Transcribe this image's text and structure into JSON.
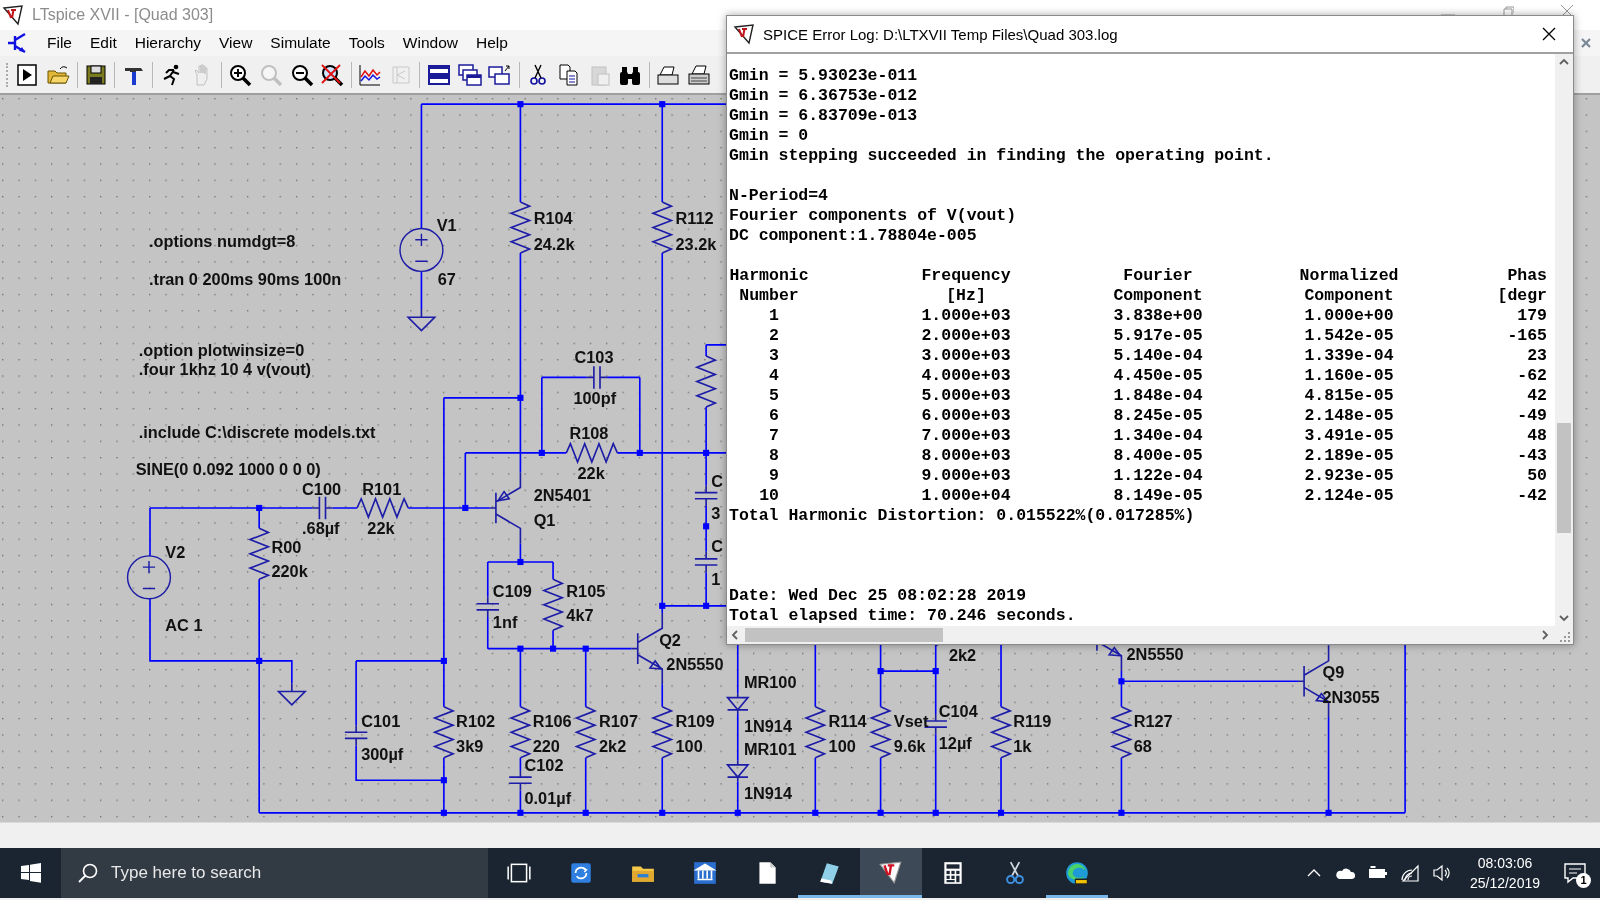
{
  "main_window": {
    "title": "LTspice XVII - [Quad 303]"
  },
  "menu": [
    "File",
    "Edit",
    "Hierarchy",
    "View",
    "Simulate",
    "Tools",
    "Window",
    "Help"
  ],
  "toolbar": [
    {
      "kind": "run",
      "disabled": false
    },
    {
      "kind": "open",
      "disabled": false
    },
    {
      "kind": "separator"
    },
    {
      "kind": "save",
      "disabled": false
    },
    {
      "kind": "separator"
    },
    {
      "kind": "hammer",
      "disabled": false
    },
    {
      "kind": "separator"
    },
    {
      "kind": "runner",
      "disabled": false
    },
    {
      "kind": "hand",
      "disabled": true
    },
    {
      "kind": "separator"
    },
    {
      "kind": "zoom-in",
      "disabled": false
    },
    {
      "kind": "zoom-area",
      "disabled": true
    },
    {
      "kind": "zoom-out",
      "disabled": false
    },
    {
      "kind": "zoom-cancel",
      "disabled": false
    },
    {
      "kind": "separator"
    },
    {
      "kind": "waveform",
      "disabled": false
    },
    {
      "kind": "symbol",
      "disabled": true
    },
    {
      "kind": "separator"
    },
    {
      "kind": "tile-horizontal",
      "disabled": false
    },
    {
      "kind": "cascade",
      "disabled": false
    },
    {
      "kind": "tile-vertical",
      "disabled": false
    },
    {
      "kind": "separator"
    },
    {
      "kind": "cut",
      "disabled": false
    },
    {
      "kind": "copy",
      "disabled": false
    },
    {
      "kind": "paste",
      "disabled": true
    },
    {
      "kind": "find",
      "disabled": false
    },
    {
      "kind": "separator"
    },
    {
      "kind": "print",
      "disabled": false
    },
    {
      "kind": "print-setup",
      "disabled": false
    }
  ],
  "schematic": {
    "directives": [
      ".options numdgt=8",
      ".tran 0 200ms 90ms 100n",
      ".option plotwinsize=0",
      ".four 1khz 10 4 v(vout)",
      ".include C:\\discrete models.txt"
    ],
    "parts": [
      {
        "kind": "voltage_source",
        "labels": [
          "V1",
          "67"
        ]
      },
      {
        "kind": "resistor",
        "labels": [
          "R104",
          "24.2k"
        ]
      },
      {
        "kind": "resistor",
        "labels": [
          "R112",
          "23.2k"
        ]
      },
      {
        "kind": "capacitor",
        "labels": [
          "C103",
          "100pf"
        ]
      },
      {
        "kind": "resistor",
        "labels": [
          "R108",
          "22k"
        ]
      },
      {
        "kind": "capacitor",
        "labels": [
          "C100",
          ".68µf"
        ]
      },
      {
        "kind": "resistor",
        "labels": [
          "R101",
          "22k"
        ]
      },
      {
        "kind": "pnp",
        "labels": [
          "2N5401",
          "Q1"
        ]
      },
      {
        "kind": "voltage_source",
        "labels": [
          "SINE(0 0.092 1000 0 0 0)",
          "V2",
          "AC 1"
        ]
      },
      {
        "kind": "resistor",
        "labels": [
          "R00",
          "220k"
        ]
      },
      {
        "kind": "capacitor",
        "labels": [
          "C109",
          "1nf"
        ]
      },
      {
        "kind": "resistor",
        "labels": [
          "R105",
          "4k7"
        ]
      },
      {
        "kind": "npn",
        "labels": [
          "Q2",
          "2N5550"
        ]
      },
      {
        "kind": "capacitor",
        "labels": [
          "C101",
          "300µf"
        ]
      },
      {
        "kind": "resistor",
        "labels": [
          "R102",
          "3k9"
        ]
      },
      {
        "kind": "resistor",
        "labels": [
          "R106",
          "220"
        ]
      },
      {
        "kind": "capacitor",
        "labels": [
          "C102",
          "0.01µf"
        ]
      },
      {
        "kind": "resistor",
        "labels": [
          "R107",
          "2k2"
        ]
      },
      {
        "kind": "resistor",
        "labels": [
          "R109",
          "100"
        ]
      },
      {
        "kind": "diode",
        "labels": [
          "MR100",
          "1N914"
        ]
      },
      {
        "kind": "diode",
        "labels": [
          "MR101",
          "1N914"
        ]
      },
      {
        "kind": "resistor",
        "labels": [
          "R114",
          "100"
        ]
      },
      {
        "kind": "resistor",
        "labels": [
          "Vset",
          "9.6k"
        ]
      },
      {
        "kind": "capacitor",
        "labels": [
          "C104",
          "12µf"
        ]
      },
      {
        "kind": "resistor",
        "labels": [
          "R119",
          "1k"
        ]
      },
      {
        "kind": "resistor",
        "labels": [
          "R127",
          "68"
        ]
      },
      {
        "kind": "npn",
        "labels": [
          "Q9",
          "2N3055"
        ]
      },
      {
        "kind": "npn",
        "labels": [
          "2N5550"
        ]
      },
      {
        "kind": "resistor"
      },
      {
        "kind": "capacitor",
        "labels": [
          "C",
          "3"
        ]
      },
      {
        "kind": "capacitor",
        "labels": [
          "C",
          "1"
        ]
      },
      {
        "kind": "resistor",
        "labels": [
          "2k2"
        ]
      },
      {
        "kind": "ground"
      },
      {
        "kind": "ground"
      }
    ]
  },
  "log_window": {
    "title": "SPICE Error Log: D:\\LTXVII Temp Files\\Quad 303.log",
    "solver_lines": [
      "Gmin = 5.93023e-011",
      "Gmin = 6.36753e-012",
      "Gmin = 6.83709e-013",
      "Gmin = 0",
      "Gmin stepping succeeded in finding the operating point."
    ],
    "fourier_lines": [
      "N-Period=4",
      "Fourier components of V(vout)",
      "DC component:1.78804e-005"
    ],
    "table": {
      "header_1": [
        "Harmonic",
        "Frequency",
        "Fourier",
        "Normalized",
        "Phas"
      ],
      "header_2": [
        "Number",
        "[Hz]",
        "Component",
        "Component",
        "[degr"
      ],
      "rows": [
        [
          "1",
          "1.000e+03",
          "3.838e+00",
          "1.000e+00",
          "179"
        ],
        [
          "2",
          "2.000e+03",
          "5.917e-05",
          "1.542e-05",
          "-165"
        ],
        [
          "3",
          "3.000e+03",
          "5.140e-04",
          "1.339e-04",
          "23"
        ],
        [
          "4",
          "4.000e+03",
          "4.450e-05",
          "1.160e-05",
          "-62"
        ],
        [
          "5",
          "5.000e+03",
          "1.848e-04",
          "4.815e-05",
          "42"
        ],
        [
          "6",
          "6.000e+03",
          "8.245e-05",
          "2.148e-05",
          "-49"
        ],
        [
          "7",
          "7.000e+03",
          "1.340e-04",
          "3.491e-05",
          "48"
        ],
        [
          "8",
          "8.000e+03",
          "8.400e-05",
          "2.189e-05",
          "-43"
        ],
        [
          "9",
          "9.000e+03",
          "1.122e-04",
          "2.923e-05",
          "50"
        ],
        [
          "10",
          "1.000e+04",
          "8.149e-05",
          "2.124e-05",
          "-42"
        ]
      ]
    },
    "thd_line": "Total Harmonic Distortion: 0.015522%(0.017285%)",
    "footer_lines": [
      "Date: Wed Dec 25 08:02:28 2019",
      "Total elapsed time: 70.246 seconds."
    ]
  },
  "taskbar": {
    "search": {
      "placeholder": "Type here to search"
    },
    "apps": [
      {
        "kind": "task-view",
        "running": false,
        "selected": false
      },
      {
        "kind": "sync",
        "running": false,
        "selected": false
      },
      {
        "kind": "explorer",
        "running": false,
        "selected": false
      },
      {
        "kind": "library",
        "running": false,
        "selected": false
      },
      {
        "kind": "document",
        "running": false,
        "selected": false
      },
      {
        "kind": "notebook",
        "running": true,
        "selected": false
      },
      {
        "kind": "ltspice",
        "running": true,
        "selected": true
      },
      {
        "kind": "calculator",
        "running": false,
        "selected": false
      },
      {
        "kind": "scissors",
        "running": false,
        "selected": false
      },
      {
        "kind": "browser",
        "running": true,
        "selected": false
      }
    ],
    "clock": {
      "time": "08:03:06",
      "date": "25/12/2019"
    },
    "notifications": {
      "count": "1"
    }
  }
}
